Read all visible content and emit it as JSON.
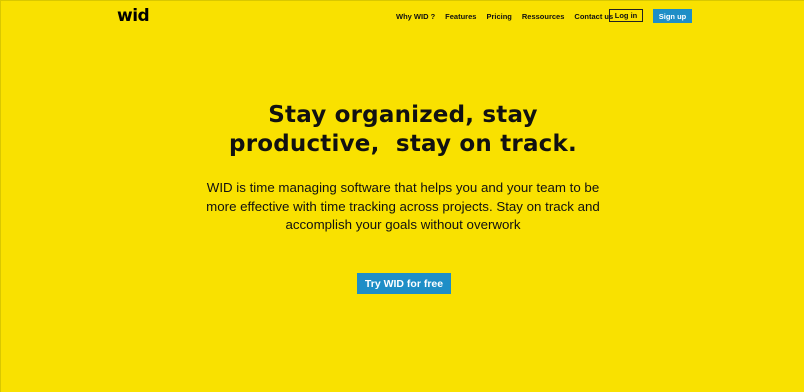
{
  "nav": {
    "logo": "wid",
    "links": [
      "Why WID ?",
      "Features",
      "Pricing",
      "Ressources",
      "Contact us"
    ],
    "login_label": "Log in",
    "signup_label": "Sign up"
  },
  "hero": {
    "title_lines": [
      "Stay organized, stay",
      "productive,  stay on track."
    ],
    "description_lines": [
      "WID is time managing software that helps you and your team to be",
      "more effective with time tracking across projects. Stay on track and",
      "accomplish your goals without overwork"
    ],
    "cta_label": "Try WID for free"
  },
  "colors": {
    "background": "#f9e100",
    "accent": "#1e8ec7",
    "text": "#111111"
  }
}
